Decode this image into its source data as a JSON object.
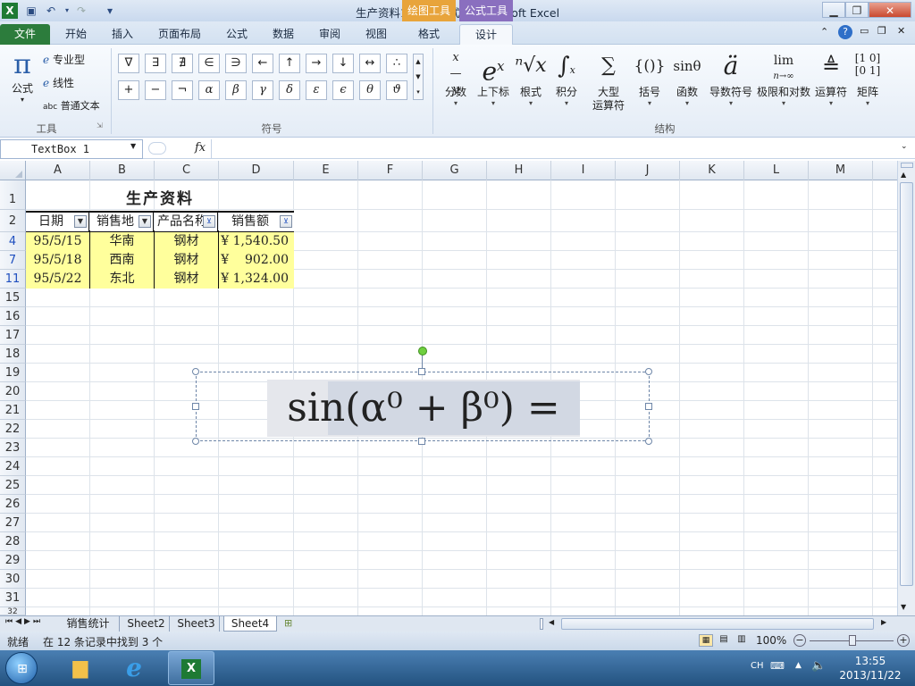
{
  "window": {
    "title": "生产资料1 [兼容模式] - Microsoft Excel",
    "context_tabs": [
      {
        "label": "绘图工具",
        "color": "#e8a43b"
      },
      {
        "label": "公式工具",
        "color": "#8a6fbf"
      }
    ]
  },
  "ribbon_tabs": [
    "文件",
    "开始",
    "插入",
    "页面布局",
    "公式",
    "数据",
    "审阅",
    "视图",
    "格式",
    "设计"
  ],
  "tools_group": {
    "main_label": "公式",
    "items": [
      "专业型",
      "线性",
      "普通文本"
    ],
    "group_label": "工具"
  },
  "symbols_group": {
    "row1": [
      "∇",
      "∃",
      "∄",
      "∈",
      "∋",
      "←",
      "↑",
      "→",
      "↓",
      "↔",
      "∴"
    ],
    "row2": [
      "+",
      "−",
      "¬",
      "α",
      "β",
      "γ",
      "δ",
      "ε",
      "ϵ",
      "θ",
      "ϑ"
    ],
    "group_label": "符号"
  },
  "structures_group": {
    "items": [
      {
        "icon": "x/y",
        "label": "分数"
      },
      {
        "icon": "eˣ",
        "label": "上下标"
      },
      {
        "icon": "ⁿ√x",
        "label": "根式"
      },
      {
        "icon": "∫",
        "label": "积分"
      },
      {
        "icon": "∑",
        "label": "大型\n运算符"
      },
      {
        "icon": "{()}",
        "label": "括号"
      },
      {
        "icon": "sinθ",
        "label": "函数"
      },
      {
        "icon": "ä",
        "label": "导数符号"
      },
      {
        "icon": "lim",
        "label": "极限和对数"
      },
      {
        "icon": "≜",
        "label": "运算符"
      },
      {
        "icon": "[10;01]",
        "label": "矩阵"
      }
    ],
    "group_label": "结构"
  },
  "formula_bar": {
    "name_box": "TextBox 1",
    "fx": "fx",
    "content": ""
  },
  "columns": [
    "A",
    "B",
    "C",
    "D",
    "E",
    "F",
    "G",
    "H",
    "I",
    "J",
    "K",
    "L",
    "M"
  ],
  "rows": [
    "1",
    "2",
    "4",
    "7",
    "11",
    "15",
    "16",
    "17",
    "18",
    "19",
    "20",
    "21",
    "22",
    "23",
    "24",
    "25",
    "26",
    "27",
    "28",
    "29",
    "30",
    "31",
    "32"
  ],
  "sheet": {
    "title": "生产资料",
    "headers": [
      "日期",
      "销售地",
      "产品名称",
      "销售额"
    ],
    "data": [
      [
        "95/5/15",
        "华南",
        "钢材",
        "¥ 1,540.50"
      ],
      [
        "95/5/18",
        "西南",
        "钢材",
        "¥    902.00"
      ],
      [
        "95/5/22",
        "东北",
        "钢材",
        "¥ 1,324.00"
      ]
    ]
  },
  "equation": {
    "text": "sin(α⁰ + β⁰) ="
  },
  "sheet_tabs": [
    "销售统计",
    "Sheet2",
    "Sheet3",
    "Sheet4"
  ],
  "active_sheet": "Sheet4",
  "status": {
    "ready": "就绪",
    "message": "在 12 条记录中找到 3 个",
    "zoom": "100%"
  },
  "taskbar": {
    "ime": "CH",
    "time": "13:55",
    "date": "2013/11/22"
  }
}
